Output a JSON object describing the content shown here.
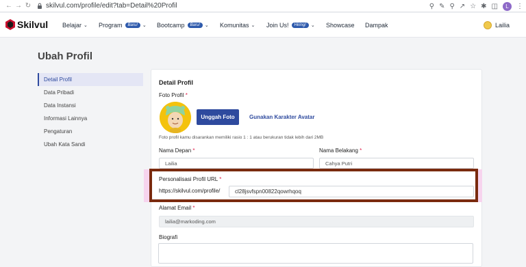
{
  "browser": {
    "url": "skilvul.com/profile/edit?tab=Detail%20Profil",
    "profile_initial": "L"
  },
  "nav": {
    "logo": "Skilvul",
    "items": [
      {
        "label": "Belajar",
        "badge": "",
        "chevron": true
      },
      {
        "label": "Program",
        "badge": "Baru!",
        "chevron": true
      },
      {
        "label": "Bootcamp",
        "badge": "Baru!",
        "chevron": true
      },
      {
        "label": "Komunitas",
        "badge": "",
        "chevron": true
      },
      {
        "label": "Join Us!",
        "badge": "Hiring!",
        "chevron": true
      },
      {
        "label": "Showcase",
        "badge": "",
        "chevron": false
      },
      {
        "label": "Dampak",
        "badge": "",
        "chevron": false
      }
    ],
    "user_name": "Lailia"
  },
  "page": {
    "title": "Ubah Profil"
  },
  "sidebar": {
    "items": [
      {
        "label": "Detail Profil",
        "active": true
      },
      {
        "label": "Data Pribadi",
        "active": false
      },
      {
        "label": "Data Instansi",
        "active": false
      },
      {
        "label": "Informasi Lainnya",
        "active": false
      },
      {
        "label": "Pengaturan",
        "active": false
      },
      {
        "label": "Ubah Kata Sandi",
        "active": false
      }
    ]
  },
  "form": {
    "heading": "Detail Profil",
    "photo_label": "Foto Profil",
    "upload_button": "Unggah Foto",
    "avatar_link": "Gunakan Karakter Avatar",
    "photo_note": "Foto profil kamu disarankan memiliki rasio 1 : 1 atau berukuran tidak lebih dari 2MB",
    "first_name_label": "Nama Depan",
    "first_name_value": "Lailia",
    "last_name_label": "Nama Belakang",
    "last_name_value": "Cahya Putri",
    "url_label": "Personalisasi Profil URL",
    "url_prefix": "https://skilvul.com/profile/",
    "url_value": "cl28jsvfspn00822qowrhqoq",
    "email_label": "Alamat Email",
    "email_value": "lailia@markoding.com",
    "bio_label": "Biografi",
    "required_mark": "*"
  },
  "colors": {
    "accent": "#2e4a9e",
    "highlight_border": "#7a2a0e",
    "highlight_glow": "#f7d4ee",
    "required": "#e11d48"
  }
}
